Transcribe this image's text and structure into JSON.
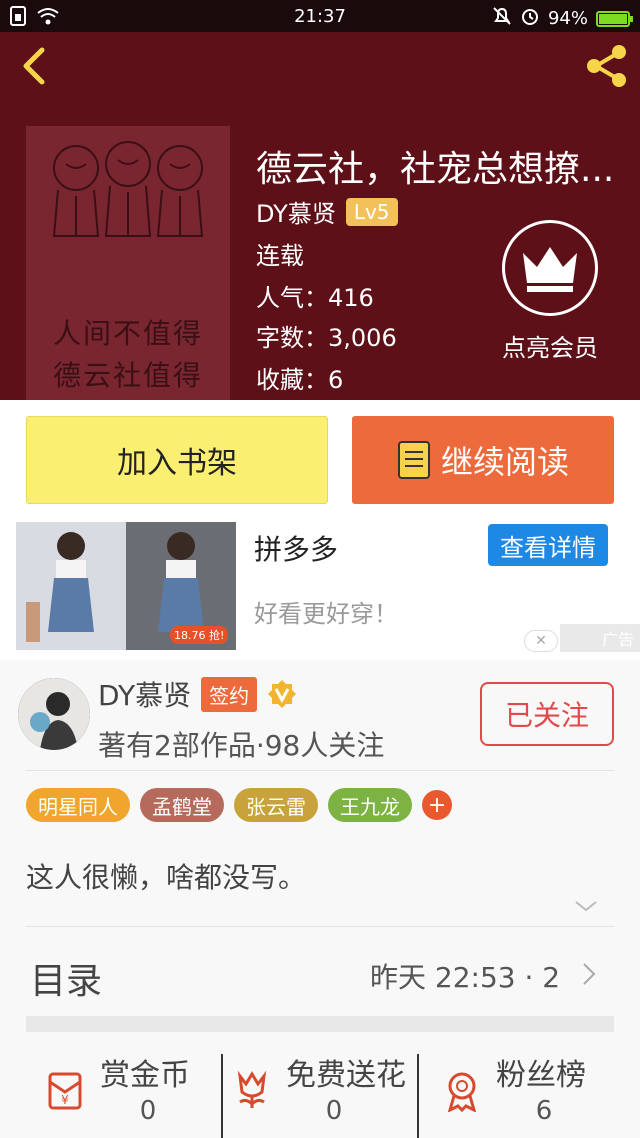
{
  "status_bar": {
    "time": "21:37",
    "battery": "94%",
    "battery_level": 0.94
  },
  "book": {
    "title": "德云社，社宠总想撩...",
    "author": "DY慕贤",
    "level": "Lv5",
    "status": "连载",
    "popularity_label": "人气：",
    "popularity": "416",
    "words_label": "字数：",
    "words": "3,006",
    "favorites_label": "收藏：",
    "favorites": "6",
    "cover_text_line1": "人间不值得",
    "cover_text_line2": "德云社值得"
  },
  "vip": {
    "label": "点亮会员"
  },
  "actions": {
    "add_shelf": "加入书架",
    "continue_read": "继续阅读"
  },
  "ad": {
    "title": "拼多多",
    "button": "查看详情",
    "description": "好看更好穿！",
    "price_tag": "18.76 抢!",
    "tag": "广告"
  },
  "author_panel": {
    "name": "DY慕贤",
    "sign_badge": "签约",
    "stats": "著有2部作品·98人关注",
    "follow_button": "已关注",
    "tags": [
      {
        "label": "明星同人",
        "color": "#f0a52c"
      },
      {
        "label": "孟鹤堂",
        "color": "#b56a5c"
      },
      {
        "label": "张云雷",
        "color": "#c8a23a"
      },
      {
        "label": "王九龙",
        "color": "#7cb342"
      }
    ],
    "tag_add": "+",
    "intro": "这人很懒，啥都没写。"
  },
  "toc": {
    "label": "目录",
    "update": "昨天 22:53 · 2"
  },
  "bottom_stats": [
    {
      "label": "赏金币",
      "value": "0"
    },
    {
      "label": "免费送花",
      "value": "0"
    },
    {
      "label": "粉丝榜",
      "value": "6"
    }
  ],
  "colors": {
    "header_bg": "#5e1018",
    "accent_orange": "#ec6a3c",
    "shelf_yellow": "#fbef72",
    "icon_red": "#d84a2e",
    "ad_blue": "#1e88e5"
  }
}
